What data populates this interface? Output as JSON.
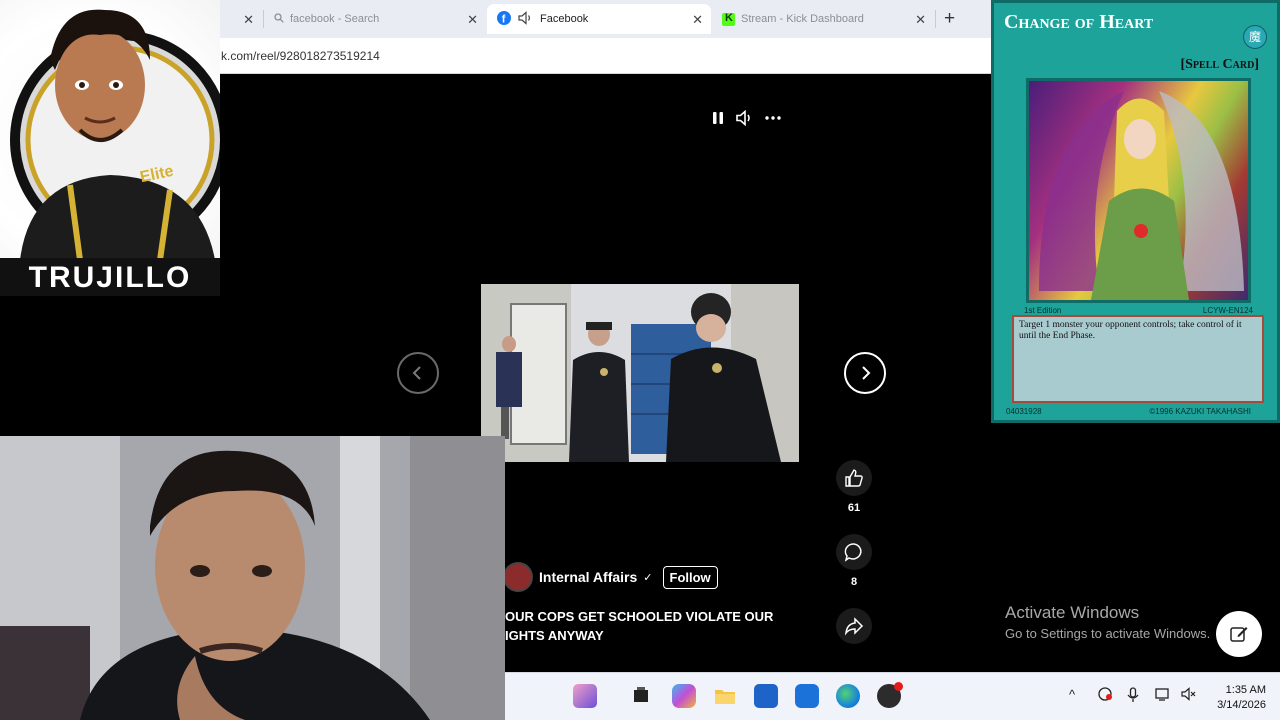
{
  "browser": {
    "tabs": [
      {
        "title": "",
        "active": false
      },
      {
        "title": "facebook - Search",
        "active": false
      },
      {
        "title": "Facebook",
        "active": true
      },
      {
        "title": "Stream - Kick Dashboard",
        "active": false
      }
    ],
    "close_glyph": "✕",
    "new_tab_glyph": "+",
    "back_glyph": "←",
    "url_visible": "k.com/reel/928018273519214"
  },
  "reel": {
    "author": "Internal Affairs",
    "verified_glyph": "✓",
    "follow_label": "Follow",
    "caption_line1": "OUR COPS GET SCHOOLED VIOLATE OUR",
    "caption_line2": "IGHTS ANYWAY",
    "likes": "61",
    "comments": "8",
    "icons": [
      "pause-icon",
      "volume-icon",
      "more-icon",
      "previous-icon",
      "next-icon",
      "like-icon",
      "comment-icon",
      "share-icon"
    ]
  },
  "overlay": {
    "banner_text": "TRUJILLO",
    "logo_badge": "Elite"
  },
  "card": {
    "name": "Change of Heart",
    "type": "[Spell Card]",
    "edition": "1st Edition",
    "set_code": "LCYW-EN124",
    "text": "Target 1 monster your opponent controls; take control of it until the End Phase.",
    "passcode": "04031928",
    "copyright": "©1996 KAZUKI TAKAHASHI",
    "symbol": "魔",
    "accent": "#1ea39a"
  },
  "windows": {
    "activate_title": "Activate Windows",
    "activate_sub": "Go to Settings to activate Windows.",
    "time": "1:35 AM",
    "date": "3/14/2026",
    "tray_up": "^"
  }
}
